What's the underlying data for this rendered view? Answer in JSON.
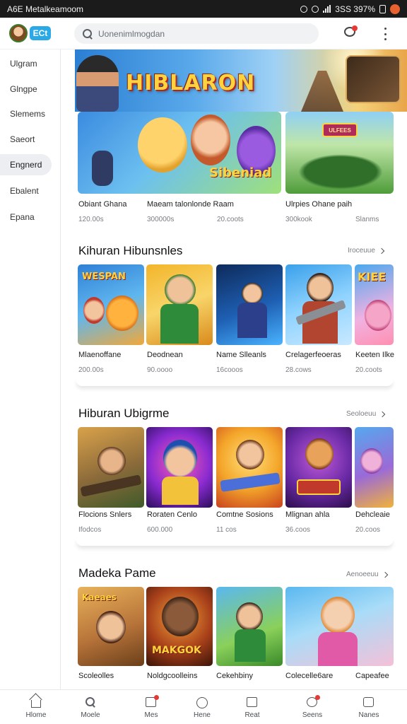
{
  "status_bar": {
    "left": "A6E  Metalkeamoom",
    "right": "3SS  397%"
  },
  "header": {
    "logo": "ECt",
    "search": {
      "placeholder": "Uonenimlmogdan"
    }
  },
  "sidebar": {
    "items": [
      {
        "label": "Ulgram"
      },
      {
        "label": "Glngpe"
      },
      {
        "label": "Slemems"
      },
      {
        "label": "Saeort"
      },
      {
        "label": "Engnerd",
        "active": true
      },
      {
        "label": "Ebalent"
      },
      {
        "label": "Epana"
      }
    ]
  },
  "banner": {
    "title": "HIBLARON"
  },
  "featured": [
    {
      "title": "Obiant Ghana",
      "subtitle": "120.00s"
    },
    {
      "title": "Maeam talonlonde Raam",
      "subtitle": "300000s"
    },
    {
      "title": "",
      "subtitle": "20.coots"
    },
    {
      "title": "Ulrpies Ohane paih",
      "subtitle": "300kook"
    },
    {
      "title": "",
      "subtitle": "Slanms"
    }
  ],
  "featured_art_text": "Sibeniad",
  "featured_art_text2": "ULFEES",
  "sections": [
    {
      "title": "Kihuran Hibunsnles",
      "more": "Iroceuue",
      "items": [
        {
          "title": "Mlaenoffane",
          "subtitle": "200.00s",
          "art_text": "WESPAN"
        },
        {
          "title": "Deodnean",
          "subtitle": "90.oooo"
        },
        {
          "title": "Name Slleanls",
          "subtitle": "16cooos"
        },
        {
          "title": "Crelagerfeoeras",
          "subtitle": "28.cows"
        },
        {
          "title": "Keeten Ilke",
          "subtitle": "20.coots",
          "art_text": "KIEE"
        }
      ]
    },
    {
      "title": "Hiburan Ubigrme",
      "more": "Seoloeuu",
      "items": [
        {
          "title": "Flocions Snlers",
          "subtitle": "Ifodcos"
        },
        {
          "title": "Roraten Cenlo",
          "subtitle": "600.000"
        },
        {
          "title": "Comtne Sosions",
          "subtitle": "11 cos"
        },
        {
          "title": "Mlignan ahla",
          "subtitle": "36.coos"
        },
        {
          "title": "Dehcleaie",
          "subtitle": "20.coos"
        }
      ]
    },
    {
      "title": "Madeka Pame",
      "more": "Aenoeeuu",
      "items": [
        {
          "title": "Scoleolles",
          "subtitle": "",
          "art_text": "Kaeaes"
        },
        {
          "title": "Noldgcoolleins",
          "subtitle": "",
          "art_text": "MAKGOK"
        },
        {
          "title": "Cekehbiny",
          "subtitle": ""
        },
        {
          "title": "Colecelle6are",
          "subtitle": ""
        },
        {
          "title": "Capeafee",
          "subtitle": ""
        }
      ]
    }
  ],
  "bottom_nav": [
    {
      "label": "Hlome",
      "icon": "home-icon"
    },
    {
      "label": "Moele",
      "icon": "search-icon"
    },
    {
      "label": "Mes",
      "icon": "document-icon"
    },
    {
      "label": "Hene",
      "icon": "circle-icon"
    },
    {
      "label": "Reat",
      "icon": "list-icon"
    },
    {
      "label": "Seens",
      "icon": "chat-icon"
    },
    {
      "label": "Nanes",
      "icon": "profile-icon"
    }
  ],
  "colors": {
    "accent": "#2aa9e6",
    "notification": "#e53935",
    "status_bar": "#1b1b1b"
  }
}
